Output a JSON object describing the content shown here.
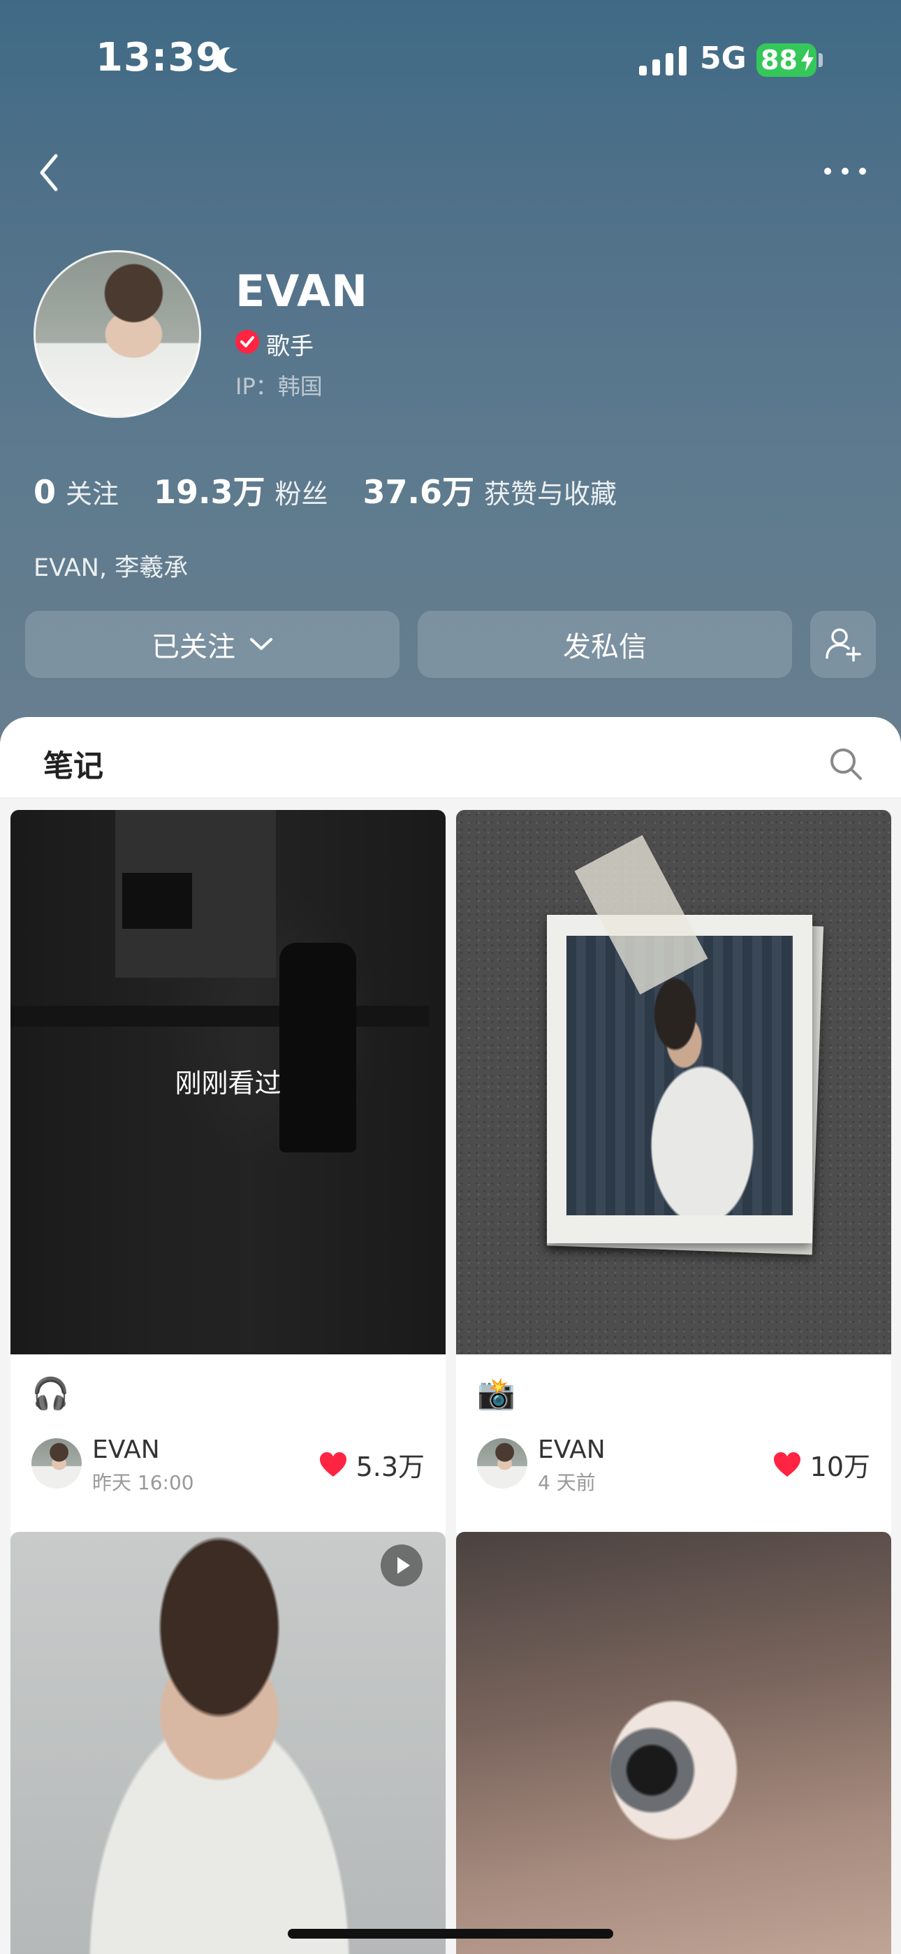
{
  "status_bar": {
    "time": "13:39",
    "network": "5G",
    "battery": "88"
  },
  "profile": {
    "name": "EVAN",
    "role": "歌手",
    "ip": "IP：韩国",
    "bio": "EVAN, 李羲承"
  },
  "stats": [
    {
      "value": "0",
      "label": "关注"
    },
    {
      "value": "19.3万",
      "label": "粉丝"
    },
    {
      "value": "37.6万",
      "label": "获赞与收藏"
    }
  ],
  "actions": {
    "following": "已关注",
    "message": "发私信"
  },
  "tabs": {
    "notes": "笔记"
  },
  "notes": [
    {
      "overlay": "刚刚看过",
      "emoji": "🎧",
      "author": "EVAN",
      "time": "昨天 16:00",
      "likes": "5.3万"
    },
    {
      "emoji": "📸",
      "author": "EVAN",
      "time": "4 天前",
      "likes": "10万"
    },
    {
      "is_video": true
    },
    {
      "is_video": false
    }
  ],
  "colors": {
    "accent": "#ff2442",
    "header_top": "#3f6a86",
    "header_bottom": "#687f8f",
    "battery": "#35c759"
  }
}
